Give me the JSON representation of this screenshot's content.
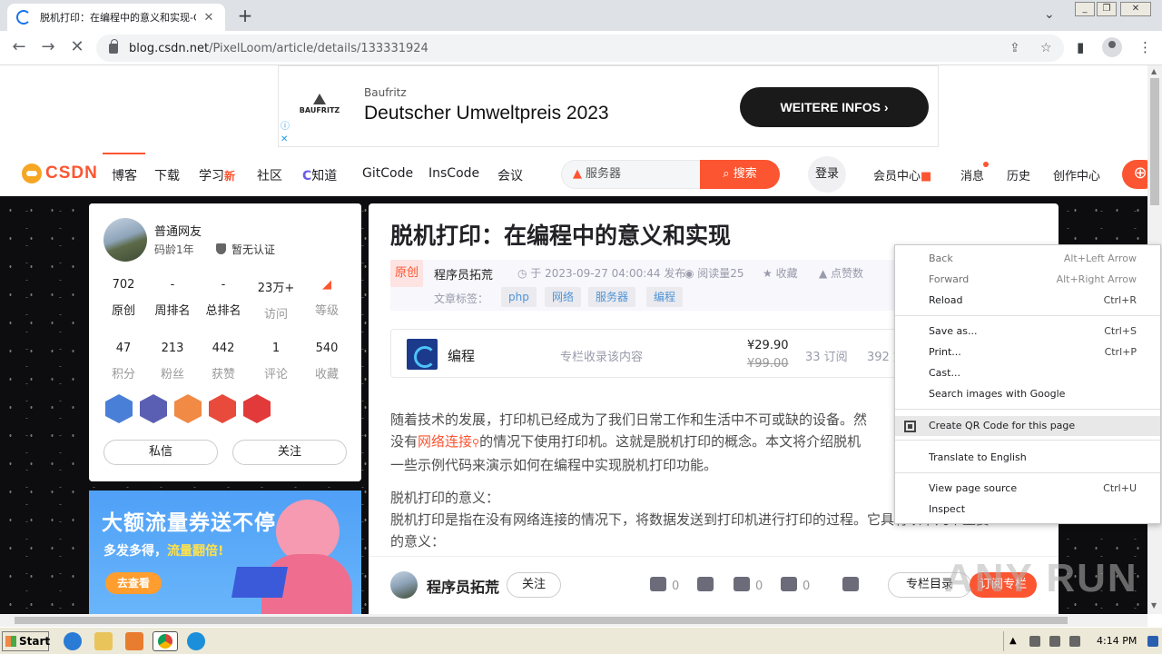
{
  "browser": {
    "tab_title": "脱机打印：在编程中的意义和实现-C",
    "tab_close": "✕",
    "new_tab": "+",
    "url_domain": "blog.csdn.net",
    "url_path": "/PixelLoom/article/details/133331924"
  },
  "ad": {
    "brand_logo": "BAUFRITZ",
    "brand": "Baufritz",
    "headline": "Deutscher Umweltpreis 2023",
    "cta": "WEITERE INFOS ›"
  },
  "nav": {
    "logo": "CSDN",
    "items": [
      "博客",
      "下载",
      "学习",
      "社区",
      "知道",
      "GitCode",
      "InsCode",
      "会议"
    ],
    "new_badge": "新",
    "search_placeholder": "服务器",
    "search_button": "搜索",
    "login": "登录",
    "right_items": [
      "会员中心",
      "消息",
      "历史",
      "创作中心"
    ]
  },
  "profile": {
    "name": "普通网友",
    "age": "码龄1年",
    "cert": "暂无认证",
    "stats_row1": [
      {
        "value": "702",
        "label": "原创"
      },
      {
        "value": "-",
        "label": "周排名"
      },
      {
        "value": "-",
        "label": "总排名"
      },
      {
        "value": "23万+",
        "label": "访问"
      },
      {
        "value": "",
        "label": "等级"
      }
    ],
    "stats_row2": [
      {
        "value": "47",
        "label": "积分"
      },
      {
        "value": "213",
        "label": "粉丝"
      },
      {
        "value": "442",
        "label": "获赞"
      },
      {
        "value": "1",
        "label": "评论"
      },
      {
        "value": "540",
        "label": "收藏"
      }
    ],
    "message_button": "私信",
    "follow_button": "关注"
  },
  "promo": {
    "title": "大额流量券送不停",
    "sub_a": "多发多得，",
    "sub_b": "流量翻倍!",
    "cta": "去查看"
  },
  "article": {
    "title": "脱机打印：在编程中的意义和实现",
    "original_tag": "原创",
    "author": "程序员拓荒",
    "date": "于 2023-09-27 04:00:44 发布",
    "reads": "阅读量25",
    "favorite": "收藏",
    "like": "点赞数",
    "tags_label": "文章标签：",
    "tags": [
      "php",
      "网络",
      "服务器",
      "编程"
    ],
    "column": {
      "name": "编程",
      "desc": "专栏收录该内容",
      "price": "¥29.90",
      "old_price": "¥99.00",
      "subs": "33 订阅",
      "articles": "392 篇"
    },
    "p1_a": "随着技术的发展，打印机已经成为了我们日常工作和生活中不可或缺的设备。然",
    "p1_b": "没有",
    "p1_link": "网络连接",
    "p1_c": "的情况下使用打印机。这就是脱机打印的概念。本文将介绍脱机",
    "p1_d": "一些示例代码来演示如何在编程中实现脱机打印功能。",
    "p2_heading": "脱机打印的意义：",
    "p2_body": "脱机打印是指在没有网络连接的情况下，将数据发送到打印机进行打印的过程。它具有以下几个重要",
    "p2_tail": "的意义："
  },
  "bottom_bar": {
    "author": "程序员拓荒",
    "follow": "关注",
    "like_count": "0",
    "star_count": "0",
    "comment_count": "0",
    "directory": "专栏目录",
    "subscribe": "订阅专栏"
  },
  "context_menu": {
    "items": [
      {
        "label": "Back",
        "shortcut": "Alt+Left Arrow"
      },
      {
        "label": "Forward",
        "shortcut": "Alt+Right Arrow"
      },
      {
        "label": "Reload",
        "shortcut": "Ctrl+R"
      },
      {
        "label": "Save as...",
        "shortcut": "Ctrl+S"
      },
      {
        "label": "Print...",
        "shortcut": "Ctrl+P"
      },
      {
        "label": "Cast...",
        "shortcut": ""
      },
      {
        "label": "Search images with Google",
        "shortcut": ""
      },
      {
        "label": "Create QR Code for this page",
        "shortcut": ""
      },
      {
        "label": "Translate to English",
        "shortcut": ""
      },
      {
        "label": "View page source",
        "shortcut": "Ctrl+U"
      },
      {
        "label": "Inspect",
        "shortcut": ""
      }
    ]
  },
  "taskbar": {
    "start": "Start",
    "clock": "4:14 PM"
  },
  "watermark": "ANY RUN",
  "colors": {
    "accent": "#fc5531",
    "link": "#5094d5"
  }
}
